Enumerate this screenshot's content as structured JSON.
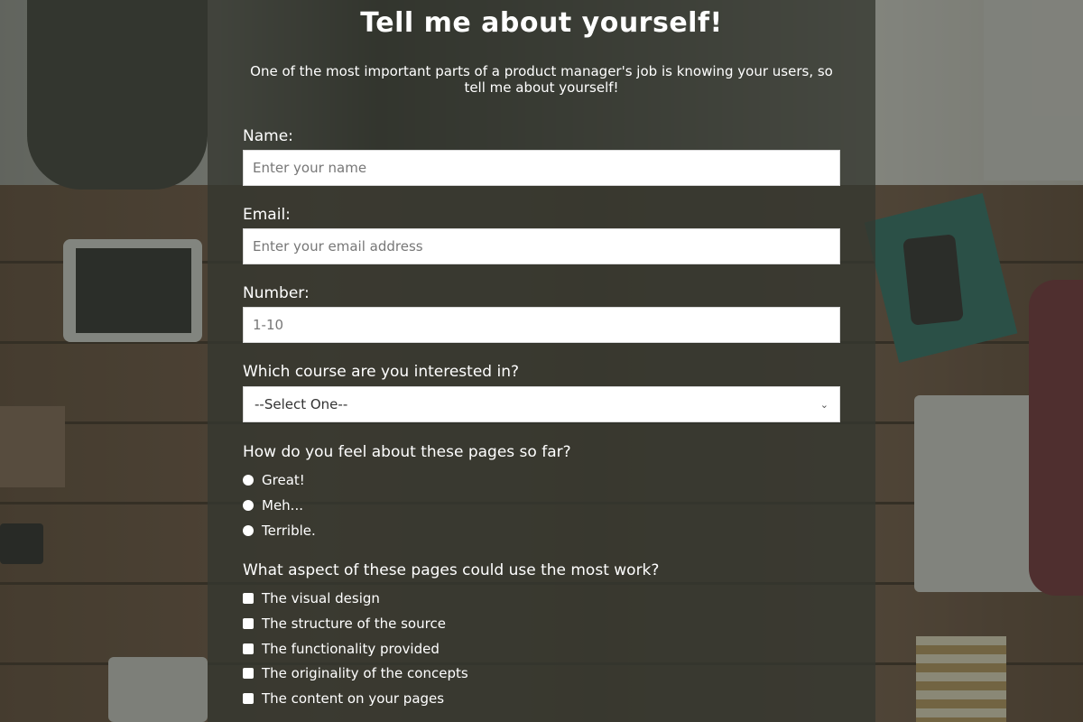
{
  "header": {
    "title": "Tell me about yourself!",
    "description": "One of the most important parts of a product manager's job is knowing your users, so tell me about yourself!"
  },
  "form": {
    "name": {
      "label": "Name:",
      "placeholder": "Enter your name",
      "value": ""
    },
    "email": {
      "label": "Email:",
      "placeholder": "Enter your email address",
      "value": ""
    },
    "number": {
      "label": "Number:",
      "placeholder": "1-10",
      "value": ""
    },
    "course": {
      "label": "Which course are you interested in?",
      "selected": "--Select One--"
    },
    "feeling": {
      "label": "How do you feel about these pages so far?",
      "options": [
        "Great!",
        "Meh...",
        "Terrible."
      ]
    },
    "aspects": {
      "label": "What aspect of these pages could use the most work?",
      "options": [
        "The visual design",
        "The structure of the source",
        "The functionality provided",
        "The originality of the concepts",
        "The content on your pages"
      ]
    }
  },
  "icons": {
    "select_chevron": "chevron-down-icon"
  }
}
